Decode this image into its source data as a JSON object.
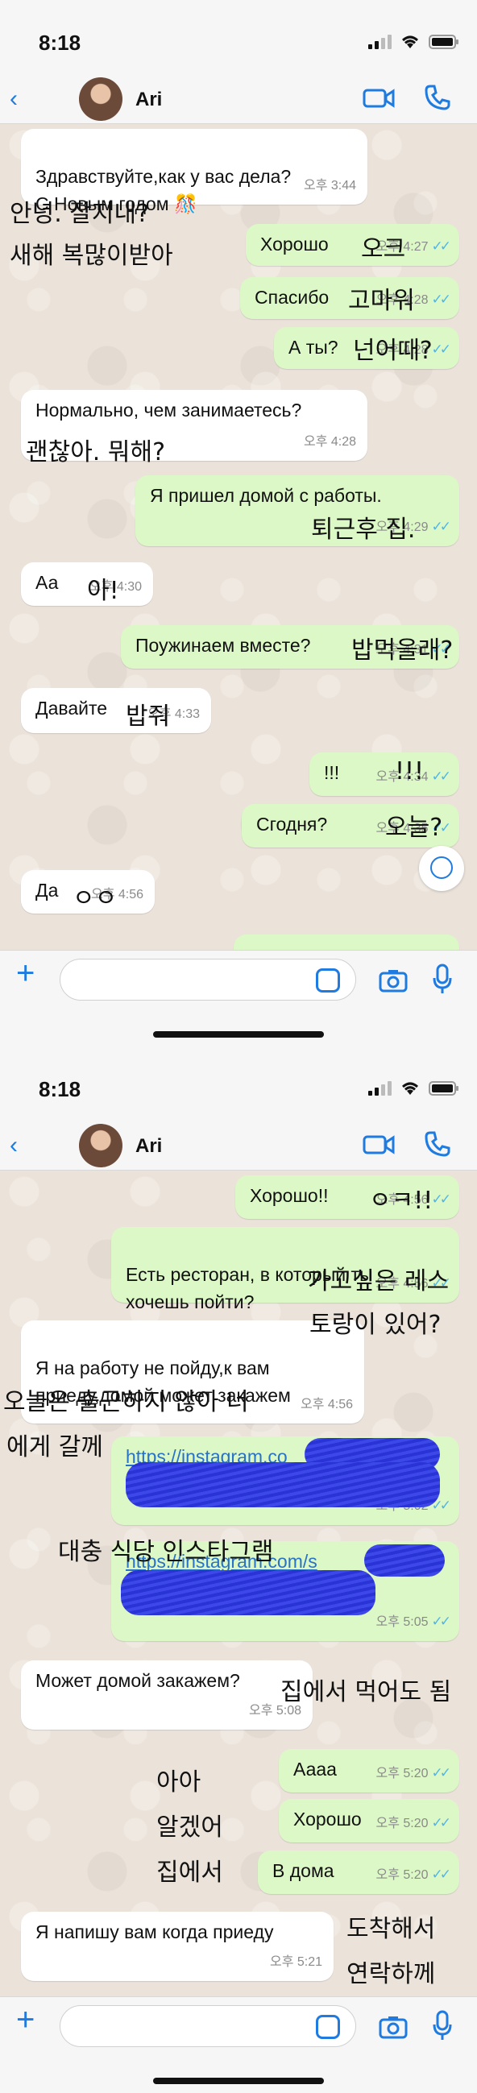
{
  "screens": [
    {
      "status": {
        "time": "8:18"
      },
      "header": {
        "back": "‹",
        "contact_name": "Ari"
      },
      "messages": [
        {
          "dir": "in",
          "text": "Здравствуйте,как у вас дела?\nС Новым годом 🎊",
          "time": "오후 3:44"
        },
        {
          "dir": "out",
          "text": "Хорошо",
          "time": "오후 4:27"
        },
        {
          "dir": "out",
          "text": "Спасибо",
          "time": "오후 4:28"
        },
        {
          "dir": "out",
          "text": "А ты?",
          "time": "오후 4:28"
        },
        {
          "dir": "in",
          "text": "Нормально, чем занимаетесь?",
          "time": "오후 4:28"
        },
        {
          "dir": "out",
          "text": "Я пришел домой с работы.",
          "time": "오후 4:29"
        },
        {
          "dir": "in",
          "text": "Аа",
          "time": "오후 4:30"
        },
        {
          "dir": "out",
          "text": "Поужинаем вместе?",
          "time": "오후 4:31"
        },
        {
          "dir": "in",
          "text": "Давайте",
          "time": "오후 4:33"
        },
        {
          "dir": "out",
          "text": "!!!",
          "time": "오후 4:34"
        },
        {
          "dir": "out",
          "text": "Сгодня?",
          "time": "오후 4:35"
        },
        {
          "dir": "in",
          "text": "Да",
          "time": "오후 4:56"
        }
      ],
      "annotations": [
        "안녕. 잘지내?",
        "새해 복많이받아",
        "오크",
        "고마워",
        "넌어때?",
        "괜찮아. 뭐해?",
        "퇴근후 집.",
        "아!",
        "밥먹을래?",
        "밥줘",
        "!!!",
        "오늘?",
        "ㅇㅇ"
      ]
    },
    {
      "status": {
        "time": "8:18"
      },
      "header": {
        "back": "‹",
        "contact_name": "Ari"
      },
      "messages": [
        {
          "dir": "out",
          "text": "Хорошо!!",
          "time": "오후 4:56"
        },
        {
          "dir": "out",
          "text": "Есть ресторан, в который ты\nхочешь пойти?",
          "time": "오후 4:56"
        },
        {
          "dir": "in",
          "text": "Я на работу не пойду,к вам\nприеду,домой может закажем",
          "time": "오후 4:56"
        },
        {
          "dir": "out",
          "text": "https://instagram.co",
          "time": "오후 5:02",
          "link": true
        },
        {
          "dir": "out",
          "text": "https://instagram.com/s",
          "time": "오후 5:05",
          "link": true
        },
        {
          "dir": "in",
          "text": "Может домой закажем?",
          "time": "오후 5:08"
        },
        {
          "dir": "out",
          "text": "Аааа",
          "time": "오후 5:20"
        },
        {
          "dir": "out",
          "text": "Хорошо",
          "time": "오후 5:20"
        },
        {
          "dir": "out",
          "text": "В дома",
          "time": "오후 5:20"
        },
        {
          "dir": "in",
          "text": "Я напишу вам когда приеду",
          "time": "오후 5:21"
        }
      ],
      "annotations": [
        "ㅇㅋ!!",
        "가고싶은 레스",
        "토랑이 있어?",
        "오늘은 출근하지 않아 너",
        "에게 갈께",
        "대충 식당 인스타그램",
        "집에서 먹어도 됨",
        "아아",
        "알겠어",
        "집에서",
        "도착해서",
        "연락하께"
      ]
    }
  ],
  "icons": [
    "chevron-left-icon",
    "video-call-icon",
    "phone-icon",
    "plus-icon",
    "sticker-icon",
    "camera-icon",
    "microphone-icon",
    "scroll-down-icon"
  ],
  "colors": {
    "accent": "#1f7be0",
    "outgoing_bubble": "#dcf8c6",
    "incoming_bubble": "#ffffff",
    "read_check": "#4fb6ec",
    "redaction": "#2a33d6"
  }
}
